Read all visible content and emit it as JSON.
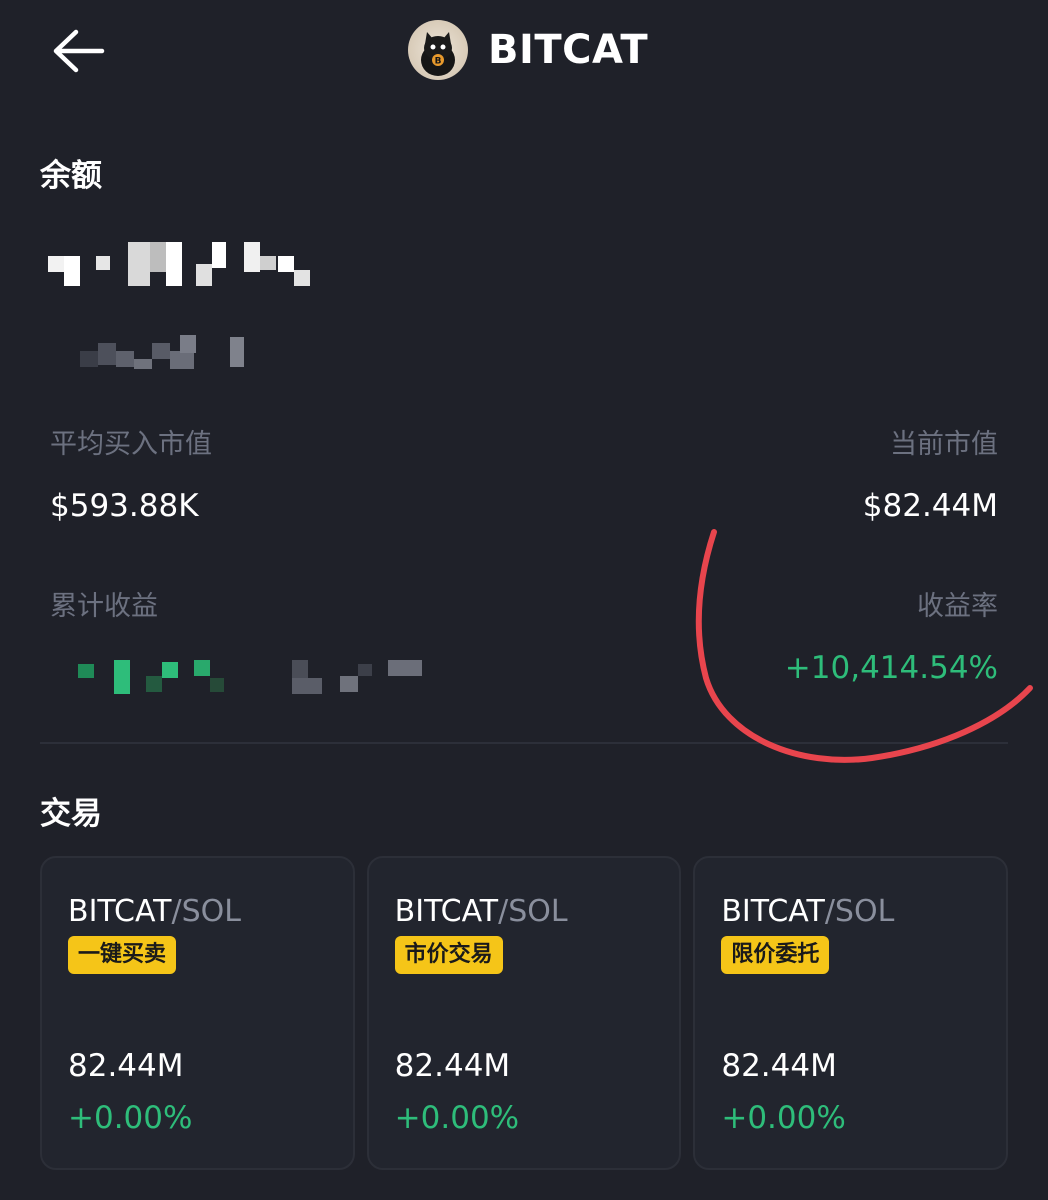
{
  "header": {
    "title": "BITCAT",
    "back_icon": "arrow-left-icon",
    "avatar_icon": "cat-avatar-icon"
  },
  "balance": {
    "section_title": "余额"
  },
  "stats": {
    "avg_buy_label": "平均买入市值",
    "avg_buy_value": "$593.88K",
    "current_label": "当前市值",
    "current_value": "$82.44M",
    "cumulative_label": "累计收益",
    "rate_label": "收益率",
    "rate_value": "+10,414.54%"
  },
  "trade": {
    "section_title": "交易",
    "cards": [
      {
        "base": "BITCAT",
        "quote": "/SOL",
        "badge": "一键买卖",
        "value": "82.44M",
        "change": "+0.00%"
      },
      {
        "base": "BITCAT",
        "quote": "/SOL",
        "badge": "市价交易",
        "value": "82.44M",
        "change": "+0.00%"
      },
      {
        "base": "BITCAT",
        "quote": "/SOL",
        "badge": "限价委托",
        "value": "82.44M",
        "change": "+0.00%"
      }
    ]
  },
  "colors": {
    "background": "#1f2129",
    "positive": "#2ebd7a",
    "badge": "#f5c518",
    "annotation": "#e8454d",
    "muted_label": "#6c7180"
  }
}
